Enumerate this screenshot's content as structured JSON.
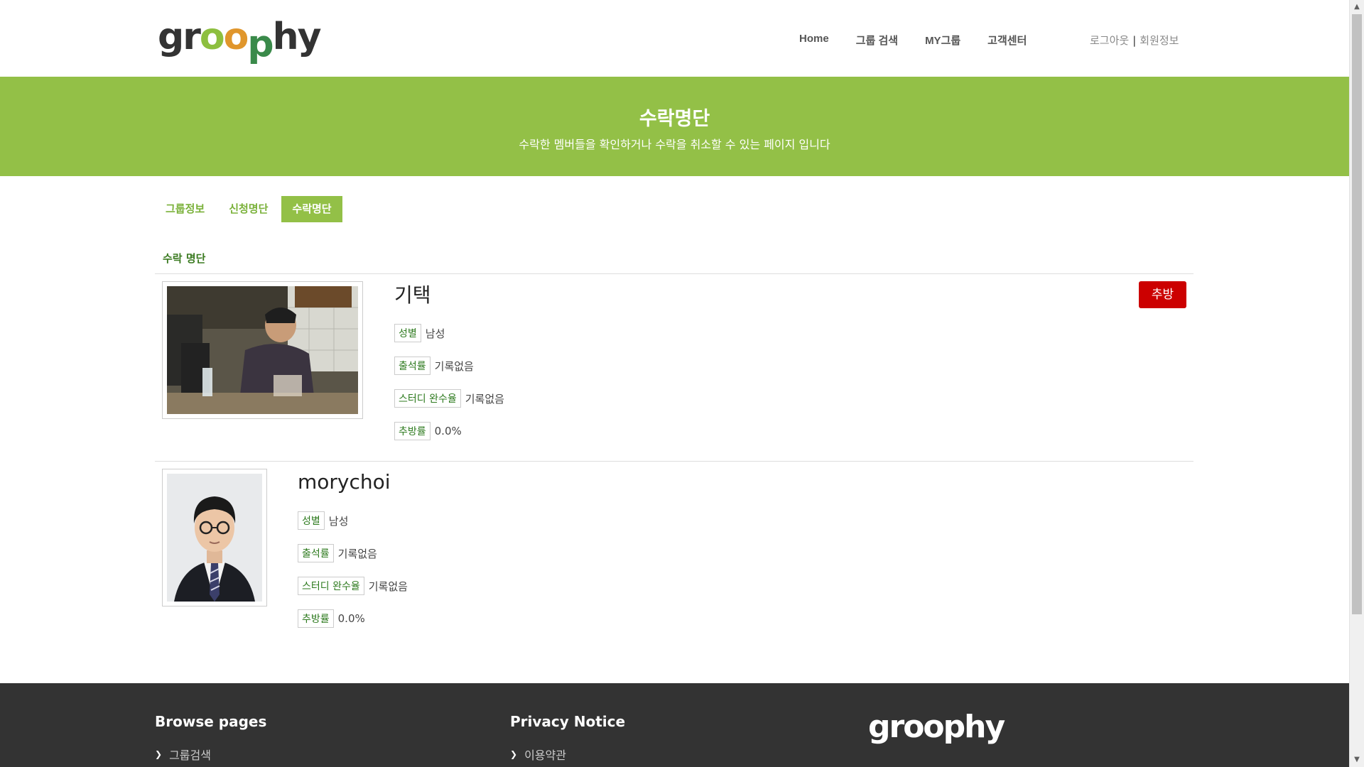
{
  "header": {
    "logo_text": "groophy",
    "nav": [
      "Home",
      "그룹 검색",
      "MY그룹",
      "고객센터"
    ],
    "logout": "로그아웃",
    "profile": "회원정보"
  },
  "banner": {
    "title": "수락명단",
    "subtitle": "수락한 멤버들을 확인하거나 수락을 취소할 수 있는 페이지 입니다"
  },
  "tabs": [
    {
      "label": "그룹정보",
      "active": false
    },
    {
      "label": "신청명단",
      "active": false
    },
    {
      "label": "수락명단",
      "active": true
    }
  ],
  "section_title": "수락 명단",
  "members": [
    {
      "name": "기택",
      "gender_label": "성별",
      "gender": "남성",
      "attendance_label": "출석률",
      "attendance": "기록없음",
      "study_label": "스터디 완수율",
      "study": "기록없음",
      "kick_label_rate": "추방률",
      "kick_rate": "0.0%",
      "kick_button": "추방"
    },
    {
      "name": "morychoi",
      "gender_label": "성별",
      "gender": "남성",
      "attendance_label": "출석률",
      "attendance": "기록없음",
      "study_label": "스터디 완수율",
      "study": "기록없음",
      "kick_label_rate": "추방률",
      "kick_rate": "0.0%"
    }
  ],
  "footer": {
    "browse_title": "Browse pages",
    "browse_link": "그룹검색",
    "privacy_title": "Privacy Notice",
    "privacy_link": "이용약관",
    "logo_text": "groophy"
  },
  "colors": {
    "accent": "#93c047",
    "danger": "#cc0000",
    "footer_bg": "#333333"
  }
}
